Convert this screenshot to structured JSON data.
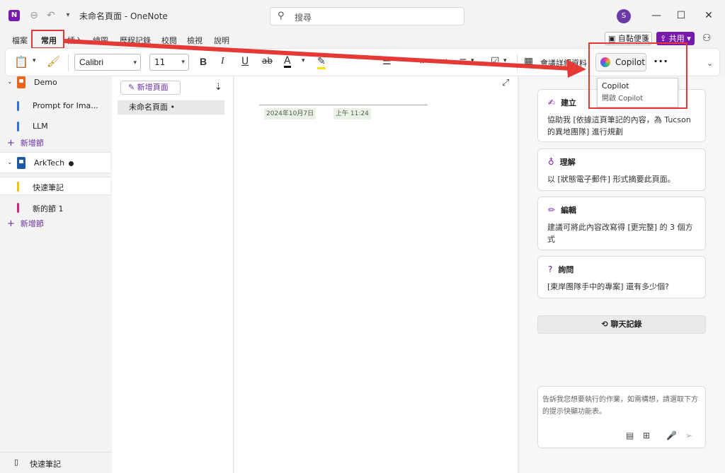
{
  "window": {
    "app_icon_letter": "N",
    "title": "未命名頁面 - OneNote",
    "search_placeholder": "搜尋",
    "avatar_letter": "S",
    "controls": [
      "—",
      "☐",
      "✕"
    ]
  },
  "menu": {
    "items": [
      "檔案",
      "常用",
      "插入",
      "繪圖",
      "歷程記錄",
      "校閱",
      "檢視",
      "說明"
    ],
    "active": "常用",
    "sticky_notes": "自黏便箋",
    "share": "共用"
  },
  "ribbon": {
    "font_name": "Calibri",
    "font_size": "11",
    "bold": "B",
    "italic": "I",
    "underline": "U",
    "strike": "ab",
    "font_color": "A",
    "meeting_details": "會議詳細資料",
    "copilot": "Copilot",
    "more": "···"
  },
  "tooltip": {
    "title": "Copilot",
    "desc": "開啟 Copilot"
  },
  "leftnav": {
    "notebooks": [
      {
        "name": "Demo",
        "color": "#e8651a",
        "sections": [
          {
            "name": "Prompt for Ima...",
            "color": "#2f6fd6"
          },
          {
            "name": "LLM",
            "color": "#2f6fd6"
          }
        ]
      },
      {
        "name": "ArkTech",
        "color": "#1e5aa8",
        "sections": [
          {
            "name": "快速筆記",
            "color": "#f2c200"
          },
          {
            "name": "新的節 1",
            "color": "#d0237d"
          }
        ]
      }
    ],
    "add_section": "新增節",
    "quick_notes": "快速筆記"
  },
  "pagelist": {
    "add_page": "新增頁面",
    "pages": [
      "未命名頁面 •"
    ]
  },
  "canvas": {
    "date": "2024年10月7日",
    "time": "上午 11:24"
  },
  "copilot_pane": {
    "cards": [
      {
        "title": "建立",
        "icon": "pen-sparkle-icon",
        "body": "協助我 [依據這頁筆記的內容，為 Tucson 的異地團隊] 進行規劃"
      },
      {
        "title": "理解",
        "icon": "lightbulb-icon",
        "body": "以 [狀態電子郵件] 形式摘要此頁面。"
      },
      {
        "title": "編輯",
        "icon": "pencil-icon",
        "body": "建議可將此內容改寫得 [更完整] 的 3 個方式"
      },
      {
        "title": "詢問",
        "icon": "question-icon",
        "body": "[東岸團隊手中的專案] 還有多少個?"
      }
    ],
    "chat_history": "聊天記錄",
    "composer_placeholder": "告訴我您想要執行的作業，如需構想，請選取下方的提示快顯功能表。"
  },
  "colors": {
    "accent": "#7719aa",
    "annotation": "#e53935"
  }
}
